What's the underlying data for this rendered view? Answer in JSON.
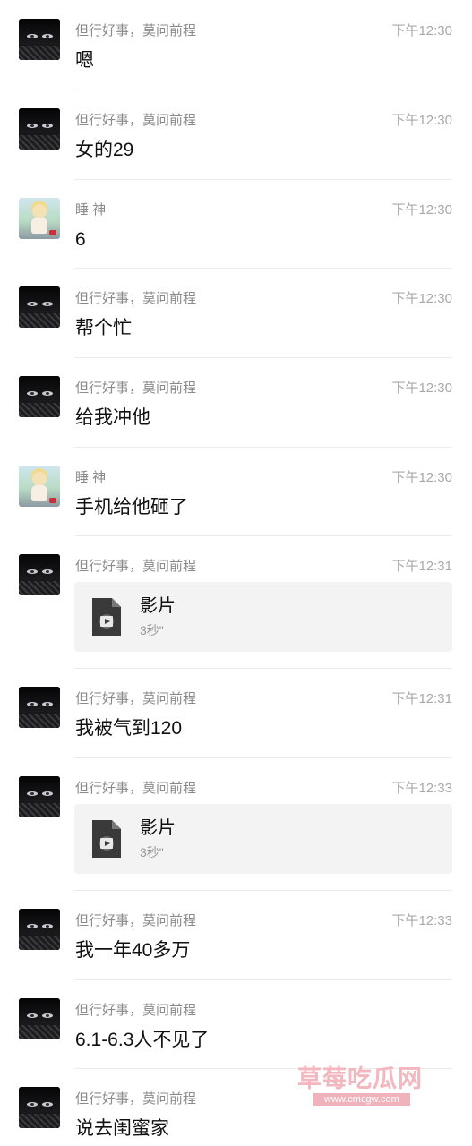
{
  "messages": [
    {
      "sender": "但行好事，莫问前程",
      "time": "下午12:30",
      "text": "嗯",
      "avatar": "dark-hair-avatar"
    },
    {
      "sender": "但行好事，莫问前程",
      "time": "下午12:30",
      "text": "女的29",
      "avatar": "dark-hair-avatar"
    },
    {
      "sender": "睡 神",
      "time": "下午12:30",
      "text": "6",
      "avatar": "anime-child-avatar"
    },
    {
      "sender": "但行好事，莫问前程",
      "time": "下午12:30",
      "text": "帮个忙",
      "avatar": "dark-hair-avatar"
    },
    {
      "sender": "但行好事，莫问前程",
      "time": "下午12:30",
      "text": "给我冲他",
      "avatar": "dark-hair-avatar"
    },
    {
      "sender": "睡 神",
      "time": "下午12:30",
      "text": "手机给他砸了",
      "avatar": "anime-child-avatar"
    },
    {
      "sender": "但行好事，莫问前程",
      "time": "下午12:31",
      "video": {
        "title": "影片",
        "duration": "3秒\""
      },
      "avatar": "dark-hair-avatar"
    },
    {
      "sender": "但行好事，莫问前程",
      "time": "下午12:31",
      "text": "我被气到120",
      "avatar": "dark-hair-avatar"
    },
    {
      "sender": "但行好事，莫问前程",
      "time": "下午12:33",
      "video": {
        "title": "影片",
        "duration": "3秒\""
      },
      "avatar": "dark-hair-avatar"
    },
    {
      "sender": "但行好事，莫问前程",
      "time": "下午12:33",
      "text": "我一年40多万",
      "avatar": "dark-hair-avatar"
    },
    {
      "sender": "但行好事，莫问前程",
      "time": "",
      "text": "6.1-6.3人不见了",
      "avatar": "dark-hair-avatar"
    },
    {
      "sender": "但行好事，莫问前程",
      "time": "",
      "text": "说去闺蜜家",
      "avatar": "dark-hair-avatar"
    }
  ],
  "watermark": {
    "title": "草莓吃瓜网",
    "url": "www.cmcgw.com"
  },
  "colors": {
    "name": "#8a8a8a",
    "time": "#a8a8a8",
    "text": "#111111",
    "card": "#f3f3f3",
    "separator": "#ececec"
  }
}
